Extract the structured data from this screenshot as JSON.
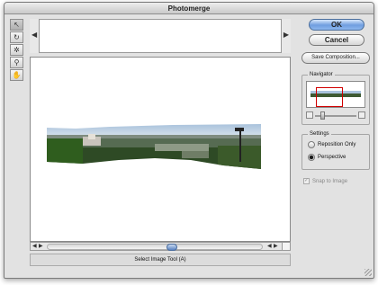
{
  "window": {
    "title": "Photomerge"
  },
  "tools": [
    {
      "name": "select-image-tool",
      "glyph": "↖"
    },
    {
      "name": "rotate-image-tool",
      "glyph": "↻"
    },
    {
      "name": "set-vanishing-point-tool",
      "glyph": "✲"
    },
    {
      "name": "zoom-tool",
      "glyph": "⚲"
    },
    {
      "name": "hand-tool",
      "glyph": "✋"
    }
  ],
  "buttons": {
    "ok": "OK",
    "cancel": "Cancel",
    "save_composition": "Save Composition..."
  },
  "navigator": {
    "label": "Navigator"
  },
  "settings": {
    "label": "Settings",
    "options": [
      {
        "label": "Reposition Only",
        "selected": false
      },
      {
        "label": "Perspective",
        "selected": true
      }
    ]
  },
  "snap_to_image": {
    "label": "Snap to Image",
    "checked": true,
    "enabled": false
  },
  "status": {
    "text": "Select Image Tool (A)"
  },
  "colors": {
    "ok_button": "#6f9ee0",
    "navigator_box": "#d10000"
  }
}
